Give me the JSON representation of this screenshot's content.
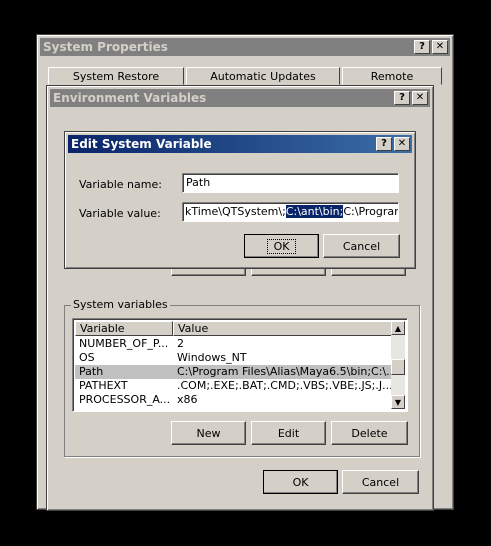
{
  "system_properties": {
    "title": "System Properties",
    "tabs": [
      "System Restore",
      "Automatic Updates",
      "Remote"
    ]
  },
  "environment_variables": {
    "title": "Environment Variables",
    "system_variables": {
      "group_label": "System variables",
      "columns": [
        "Variable",
        "Value"
      ],
      "rows": [
        {
          "variable": "NUMBER_OF_P...",
          "value": "2"
        },
        {
          "variable": "OS",
          "value": "Windows_NT"
        },
        {
          "variable": "Path",
          "value": "C:\\Program Files\\Alias\\Maya6.5\\bin;C:\\..."
        },
        {
          "variable": "PATHEXT",
          "value": ".COM;.EXE;.BAT;.CMD;.VBS;.VBE;.JS;.J..."
        },
        {
          "variable": "PROCESSOR_A...",
          "value": "x86"
        }
      ],
      "new_label": "New",
      "edit_label": "Edit",
      "delete_label": "Delete"
    },
    "ok_label": "OK",
    "cancel_label": "Cancel"
  },
  "edit_system_variable": {
    "title": "Edit System Variable",
    "name_label": "Variable name:",
    "name_value": "Path",
    "value_label": "Variable value:",
    "value_before": "kTime\\QTSystem\\;",
    "value_selected": "C:\\ant\\bin;",
    "value_after": "C:\\Program Fi",
    "ok_label": "OK",
    "cancel_label": "Cancel"
  },
  "title_buttons": {
    "help": "?",
    "close": "✕"
  }
}
